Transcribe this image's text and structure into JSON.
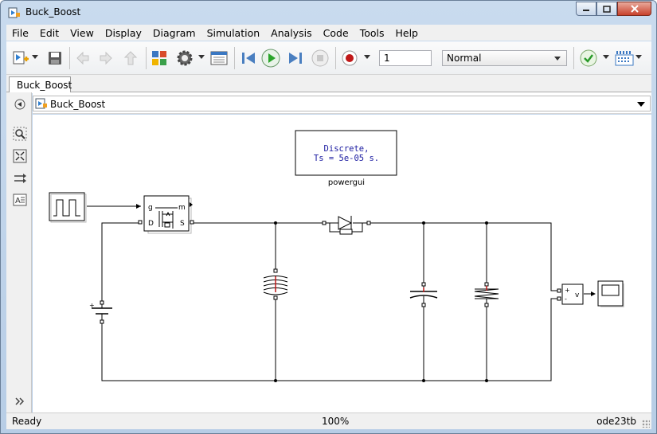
{
  "window": {
    "title": "Buck_Boost"
  },
  "menu": [
    "File",
    "Edit",
    "View",
    "Display",
    "Diagram",
    "Simulation",
    "Analysis",
    "Code",
    "Tools",
    "Help"
  ],
  "toolbar": {
    "stop_time": "1",
    "sim_mode": "Normal"
  },
  "tabs": [
    {
      "label": "Buck_Boost"
    }
  ],
  "address": {
    "path": "Buck_Boost"
  },
  "diagram": {
    "powergui": {
      "line1": "Discrete,",
      "line2": "Ts = 5e-05 s.",
      "label": "powergui"
    },
    "mosfet": {
      "port_g": "g",
      "port_m": "m",
      "port_d": "D",
      "port_s": "S"
    },
    "voltmeter": {
      "plus": "+",
      "minus": "-",
      "v": "v"
    }
  },
  "status": {
    "left": "Ready",
    "zoom": "100%",
    "solver": "ode23tb"
  },
  "colors": {
    "powergui_text": "#1a1aa0",
    "play_green": "#2aa52a",
    "record_red": "#c01818"
  }
}
